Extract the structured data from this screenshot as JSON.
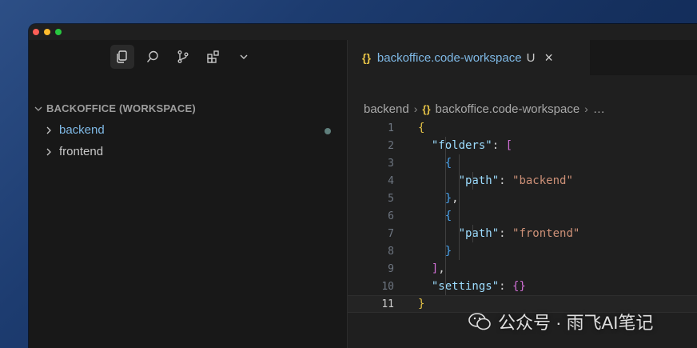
{
  "sidebar": {
    "workspace_title": "BACKOFFICE (WORKSPACE)",
    "folders": [
      {
        "label": "backend",
        "modified": true
      },
      {
        "label": "frontend",
        "modified": false
      }
    ],
    "activity": [
      "explorer-icon",
      "search-icon",
      "source-control-icon",
      "extensions-icon",
      "chevron-down-icon"
    ]
  },
  "editor": {
    "tab": {
      "icon": "{}",
      "title": "backoffice.code-workspace",
      "status": "U",
      "close": "×"
    },
    "breadcrumb": {
      "folder": "backend",
      "icon": "{}",
      "file": "backoffice.code-workspace",
      "more": "…",
      "separator": "›"
    },
    "current_line": 11
  },
  "watermark": {
    "text": "公众号 · 雨飞AI笔记"
  },
  "colors": {
    "accent_blue": "#7fb9e6",
    "json_brace": "#e8c547",
    "json_bracket": "#d16fd6",
    "json_key": "#9cdcfe",
    "json_string": "#ce9178"
  }
}
